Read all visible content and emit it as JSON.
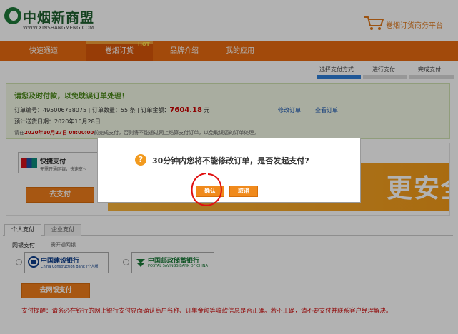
{
  "header": {
    "logo_text": "中烟新商盟",
    "logo_url": "WWW.XINSHANGMENG.COM",
    "platform": "卷烟订货商务平台"
  },
  "nav": {
    "items": [
      "快速通道",
      "卷烟订货",
      "品牌介绍",
      "我的应用"
    ],
    "hot_badge": "HOT"
  },
  "steps": [
    "选择支付方式",
    "进行支付",
    "完成支付"
  ],
  "notice": {
    "title": "请您及时付款，以免耽误订单处理！",
    "order_no_label": "订单编号：",
    "order_no": "495006738075",
    "qty_label": "订单数量：",
    "qty": "55 条",
    "amount_label": "订单金额：",
    "amount": "7604.18",
    "currency": "元",
    "modify_link": "修改订单",
    "view_link": "查看订单",
    "delivery_label": "预计送货日期：",
    "delivery_date": "2020年10月28日",
    "deadline_prefix": "请在",
    "deadline": "2020年10月27日 08:00:00",
    "deadline_suffix": "前完成支付，否则将不能通过网上结算支付订单，以免耽误您的订单处理。"
  },
  "quick_pay": {
    "title": "快捷支付",
    "subtitle": "无需开通网银，快速支付",
    "pay_button": "去支付",
    "banner_text": "更安全"
  },
  "tabs": [
    "个人支付",
    "企业支付"
  ],
  "bank": {
    "label": "网银支付",
    "sub": "需开通网银",
    "ccb_name": "中国建设银行",
    "ccb_en": "China Construction Bank",
    "ccb_sub": "(个人版)",
    "psbc_name": "中国邮政储蓄银行",
    "psbc_en": "POSTAL SAVINGS BANK OF CHINA",
    "online_button": "去网银支付"
  },
  "tip": "支付提醒：请务必在银行的网上银行支付界面确认商户名称、订单金额等收款信息是否正确。若不正确，请不要支付并联系客户经理解决。",
  "dialog": {
    "icon": "?",
    "message": "30分钟内您将不能修改订单，是否发起支付?",
    "confirm": "确认",
    "cancel": "取消"
  },
  "colors": {
    "nav_orange": "#e86a10",
    "button_orange": "#f07d1a",
    "notice_green": "#4d8a1c",
    "warning_red": "#d01010",
    "link_blue": "#1a56b0",
    "annotation_red": "#e01010"
  },
  "icons": [
    "logo-icon",
    "cart-icon",
    "unionpay-icon",
    "ccb-icon",
    "psbc-icon",
    "question-icon"
  ]
}
